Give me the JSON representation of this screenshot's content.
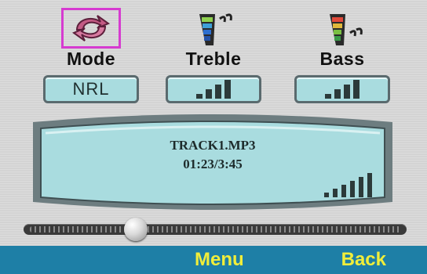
{
  "controls": {
    "mode": {
      "label": "Mode",
      "value": "NRL",
      "icon": "repeat-mode-icon",
      "selected": true,
      "selection_color": "#d63bd0"
    },
    "treble": {
      "label": "Treble",
      "icon": "treble-icon",
      "level_bars": 4
    },
    "bass": {
      "label": "Bass",
      "icon": "bass-icon",
      "level_bars": 4
    }
  },
  "display": {
    "track": "TRACK1.MP3",
    "time": "01:23/3:45",
    "volume_bars": 6
  },
  "progress": {
    "fraction": 0.28
  },
  "softkeys": {
    "menu": "Menu",
    "back": "Back"
  },
  "colors": {
    "lcd": "#a9dcdf",
    "softbar": "#1e7fa6",
    "softkey_text": "#f1ee3a"
  }
}
